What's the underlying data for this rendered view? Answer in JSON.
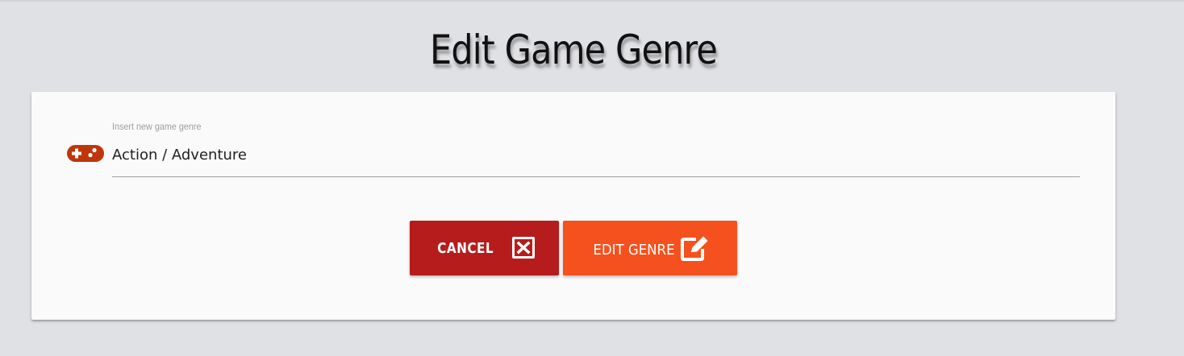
{
  "page": {
    "title": "Edit Game Genre"
  },
  "form": {
    "label": "Insert new game genre",
    "value": "Action / Adventure",
    "icon": "gamepad-icon"
  },
  "buttons": {
    "cancel_label": "CANCEL",
    "cancel_icon": "close-box-icon",
    "edit_label": "EDIT GENRE",
    "edit_icon": "edit-square-icon"
  },
  "colors": {
    "background": "#e0e1e5",
    "card": "#fafafa",
    "cancel": "#b71c1c",
    "edit": "#f4511e",
    "icon_accent": "#bf360c"
  }
}
